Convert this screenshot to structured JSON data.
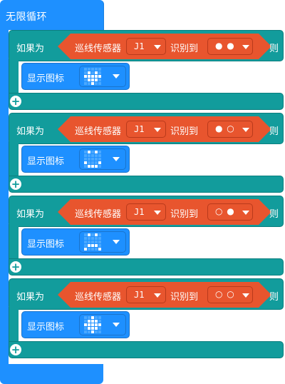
{
  "forever": {
    "label": "无限循环"
  },
  "blocks": [
    {
      "if_label": "如果为",
      "sensor_label": "巡线传感器",
      "port": "J1",
      "detect_label": "识别到",
      "dots": "● ●",
      "then_label": "则",
      "show_label": "显示图标",
      "add": "+",
      "icon_rows": [
        "00000",
        "01010",
        "11111",
        "01110",
        "00100"
      ]
    },
    {
      "if_label": "如果为",
      "sensor_label": "巡线传感器",
      "port": "J1",
      "detect_label": "识别到",
      "dots": "● ○",
      "then_label": "则",
      "show_label": "显示图标",
      "add": "+",
      "icon_rows": [
        "01010",
        "00000",
        "00000",
        "10001",
        "01110"
      ]
    },
    {
      "if_label": "如果为",
      "sensor_label": "巡线传感器",
      "port": "J1",
      "detect_label": "识别到",
      "dots": "○ ●",
      "then_label": "则",
      "show_label": "显示图标",
      "add": "+",
      "icon_rows": [
        "01010",
        "00000",
        "00000",
        "01110",
        "10001"
      ]
    },
    {
      "if_label": "如果为",
      "sensor_label": "巡线传感器",
      "port": "J1",
      "detect_label": "识别到",
      "dots": "○ ○",
      "then_label": "则",
      "show_label": "显示图标",
      "add": "+",
      "icon_rows": [
        "00100",
        "01110",
        "11111",
        "01110",
        "00100"
      ]
    }
  ],
  "colors": {
    "forever": "#1e90ff",
    "if_block": "#129c9c",
    "sensor": "#e8552e",
    "pixel_on": "#ffffff",
    "pixel_off": "#4aa8ff"
  }
}
